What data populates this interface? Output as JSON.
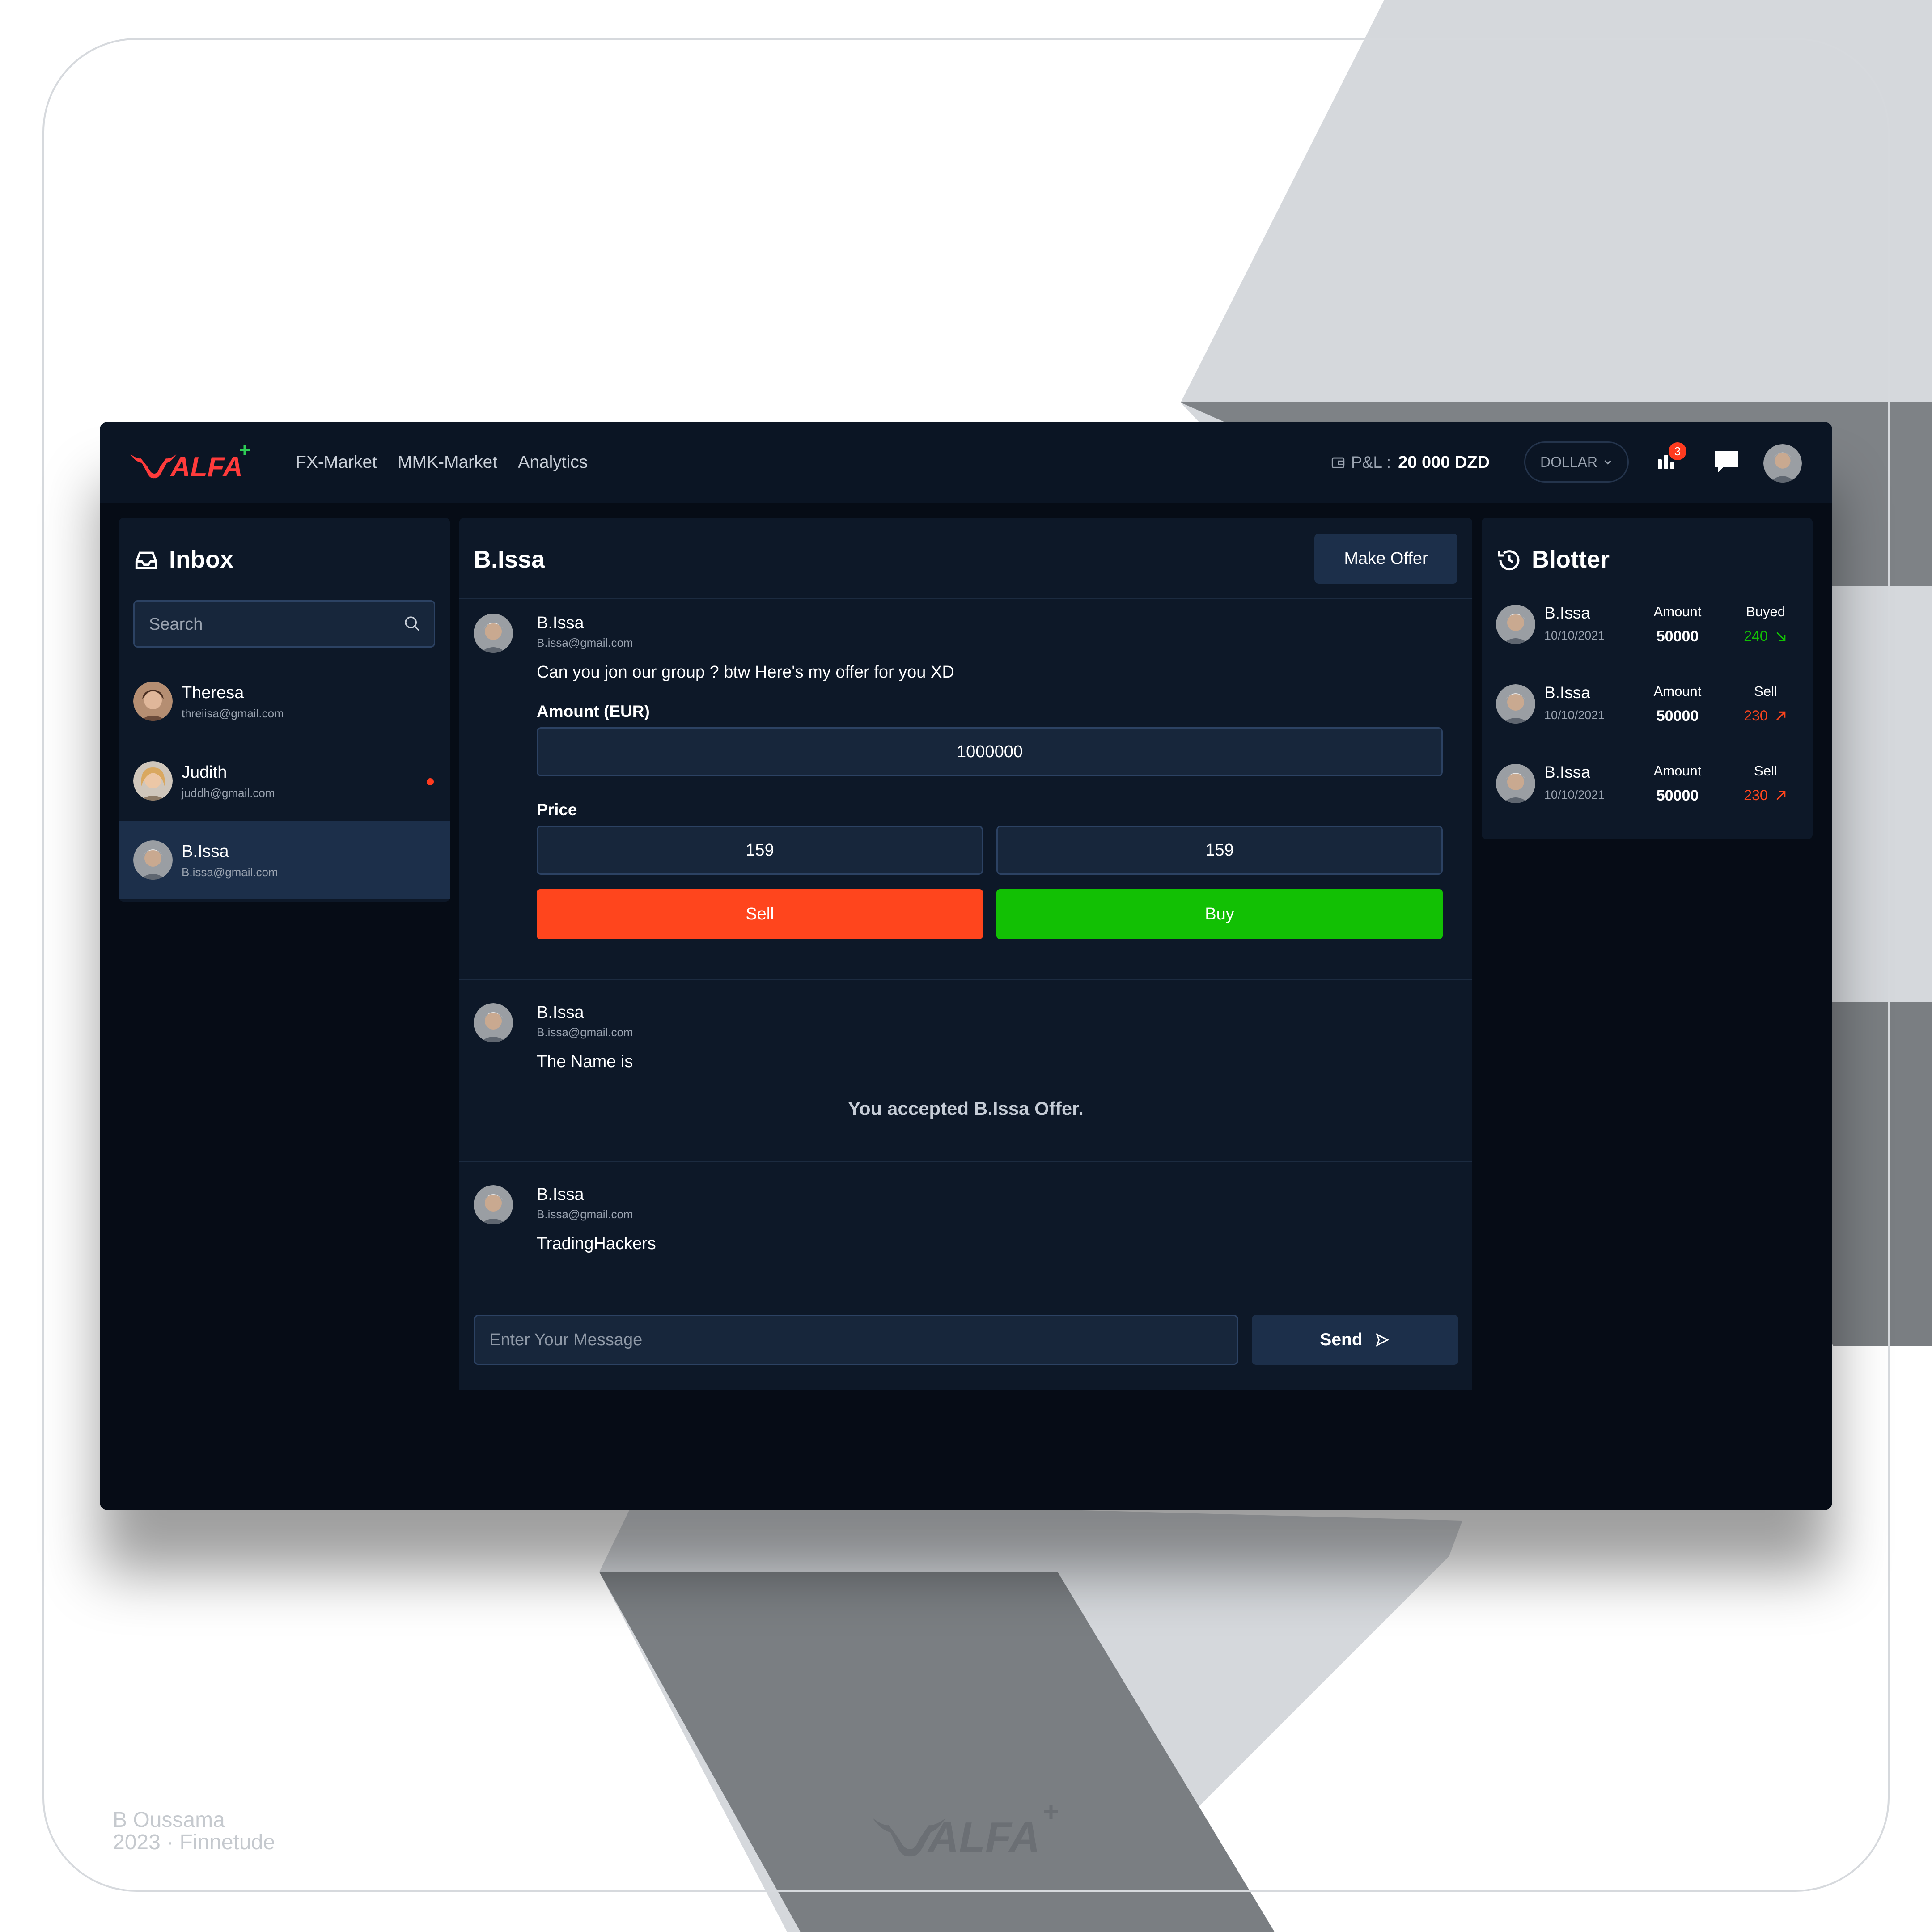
{
  "app": {
    "brand": "ALFA",
    "nav": [
      "FX-Market",
      "MMK-Market",
      "Analytics"
    ],
    "pl_label": "P&L :",
    "pl_value": "20 000 DZD",
    "currency": "DOLLAR",
    "notifications_count": "3",
    "icons": {
      "wallet": "wallet-icon",
      "chevron": "chevron-down-icon",
      "notifications": "signal-bars-icon",
      "messages": "chat-bubble-icon",
      "search": "search-icon",
      "inbox": "inbox-tray-icon",
      "history": "history-clock-icon",
      "send": "send-arrow-icon"
    },
    "colors": {
      "accent": "#ff3b1f",
      "sell": "#ff451d",
      "buy": "#12c004",
      "panel": "#0d1828",
      "surface": "#060c16"
    }
  },
  "inbox": {
    "title": "Inbox",
    "search_placeholder": "Search",
    "contacts": [
      {
        "name": "Theresa",
        "email": "threiisa@gmail.com",
        "unread": false
      },
      {
        "name": "Judith",
        "email": "juddh@gmail.com",
        "unread": true
      },
      {
        "name": "B.Issa",
        "email": "B.issa@gmail.com",
        "unread": false,
        "active": true
      }
    ]
  },
  "chat": {
    "title": "B.Issa",
    "make_offer_label": "Make Offer",
    "messages": [
      {
        "name": "B.Issa",
        "email": "B.issa@gmail.com",
        "text": "Can you  jon our group ? btw Here's my offer for you XD",
        "offer": {
          "amount_label": "Amount (EUR)",
          "amount_value": "1000000",
          "price_label": "Price",
          "price_sell": "159",
          "price_buy": "159",
          "sell_label": "Sell",
          "buy_label": "Buy"
        }
      },
      {
        "name": "B.Issa",
        "email": "B.issa@gmail.com",
        "text": "The Name is",
        "status": "You accepted B.Issa Offer."
      },
      {
        "name": "B.Issa",
        "email": "B.issa@gmail.com",
        "text": "TradingHackers"
      }
    ],
    "composer_placeholder": "Enter Your Message",
    "send_label": "Send"
  },
  "blotter": {
    "title": "Blotter",
    "rows": [
      {
        "name": "B.Issa",
        "date": "10/10/2021",
        "amount_label": "Amount",
        "amount": "50000",
        "side": "Buyed",
        "value": "240",
        "trend": "down",
        "color": "#12c004"
      },
      {
        "name": "B.Issa",
        "date": "10/10/2021",
        "amount_label": "Amount",
        "amount": "50000",
        "side": "Sell",
        "value": "230",
        "trend": "up",
        "color": "#ff451d"
      },
      {
        "name": "B.Issa",
        "date": "10/10/2021",
        "amount_label": "Amount",
        "amount": "50000",
        "side": "Sell",
        "value": "230",
        "trend": "up",
        "color": "#ff451d"
      }
    ]
  },
  "footer": {
    "author": "B Oussama",
    "year_studio": "2023 · Finnetude"
  }
}
